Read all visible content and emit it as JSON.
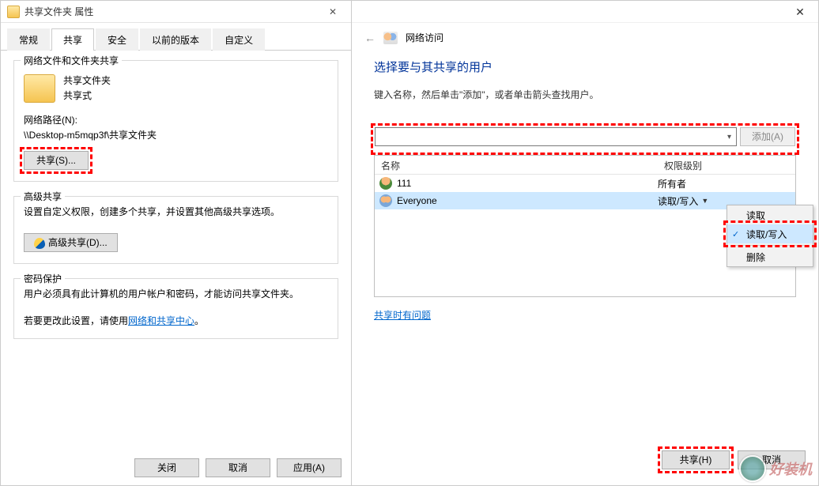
{
  "left": {
    "title": "共享文件夹 属性",
    "tabs": [
      "常规",
      "共享",
      "安全",
      "以前的版本",
      "自定义"
    ],
    "active_tab": 1,
    "grp1": {
      "title": "网络文件和文件夹共享",
      "folder_name": "共享文件夹",
      "folder_state": "共享式",
      "netpath_label": "网络路径(N):",
      "netpath_value": "\\\\Desktop-m5mqp3f\\共享文件夹",
      "share_btn": "共享(S)..."
    },
    "grp2": {
      "title": "高级共享",
      "desc": "设置自定义权限，创建多个共享，并设置其他高级共享选项。",
      "btn": "高级共享(D)..."
    },
    "grp3": {
      "title": "密码保护",
      "line1": "用户必须具有此计算机的用户帐户和密码，才能访问共享文件夹。",
      "line2_prefix": "若要更改此设置，请使用",
      "link": "网络和共享中心",
      "line2_suffix": "。"
    },
    "buttons": {
      "close": "关闭",
      "cancel": "取消",
      "apply": "应用(A)"
    }
  },
  "right": {
    "breadcrumb": "网络访问",
    "heading": "选择要与其共享的用户",
    "subheading": "键入名称，然后单击\"添加\"，或者单击箭头查找用户。",
    "add_btn": "添加(A)",
    "columns": {
      "name": "名称",
      "perm": "权限级别"
    },
    "rows": [
      {
        "name": "111",
        "perm": "所有者",
        "icon": "single",
        "selected": false,
        "has_arrow": false
      },
      {
        "name": "Everyone",
        "perm": "读取/写入",
        "icon": "group",
        "selected": true,
        "has_arrow": true
      }
    ],
    "perm_menu": {
      "items": [
        "读取",
        "读取/写入"
      ],
      "selected_index": 1,
      "delete": "删除"
    },
    "trouble_link": "共享时有问题",
    "buttons": {
      "share": "共享(H)",
      "cancel": "取消"
    }
  },
  "watermark": "好装机"
}
